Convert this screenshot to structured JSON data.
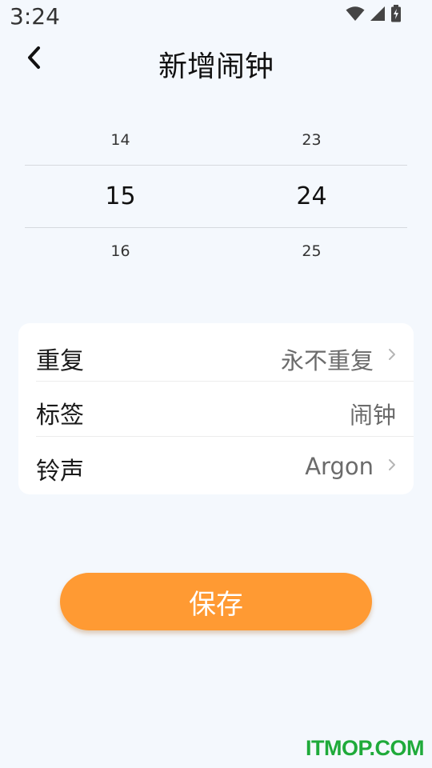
{
  "status_bar": {
    "time": "3:24",
    "icons": [
      "wifi-icon",
      "cellular-signal-icon",
      "battery-charging-icon"
    ]
  },
  "header": {
    "title": "新增闹钟",
    "back_icon": "chevron-left-icon"
  },
  "time_picker": {
    "hours": {
      "prev": "14",
      "current": "15",
      "next": "16"
    },
    "minutes": {
      "prev": "23",
      "current": "24",
      "next": "25"
    }
  },
  "settings": {
    "repeat": {
      "label": "重复",
      "value": "永不重复"
    },
    "tag": {
      "label": "标签",
      "value": "闹钟"
    },
    "ringtone": {
      "label": "铃声",
      "value": "Argon"
    }
  },
  "save_button": {
    "label": "保存"
  },
  "watermark": "ITMOP.COM",
  "colors": {
    "background": "#f4f8fd",
    "accent": "#ff9a33",
    "card": "#ffffff",
    "watermark": "#1faa3a"
  }
}
